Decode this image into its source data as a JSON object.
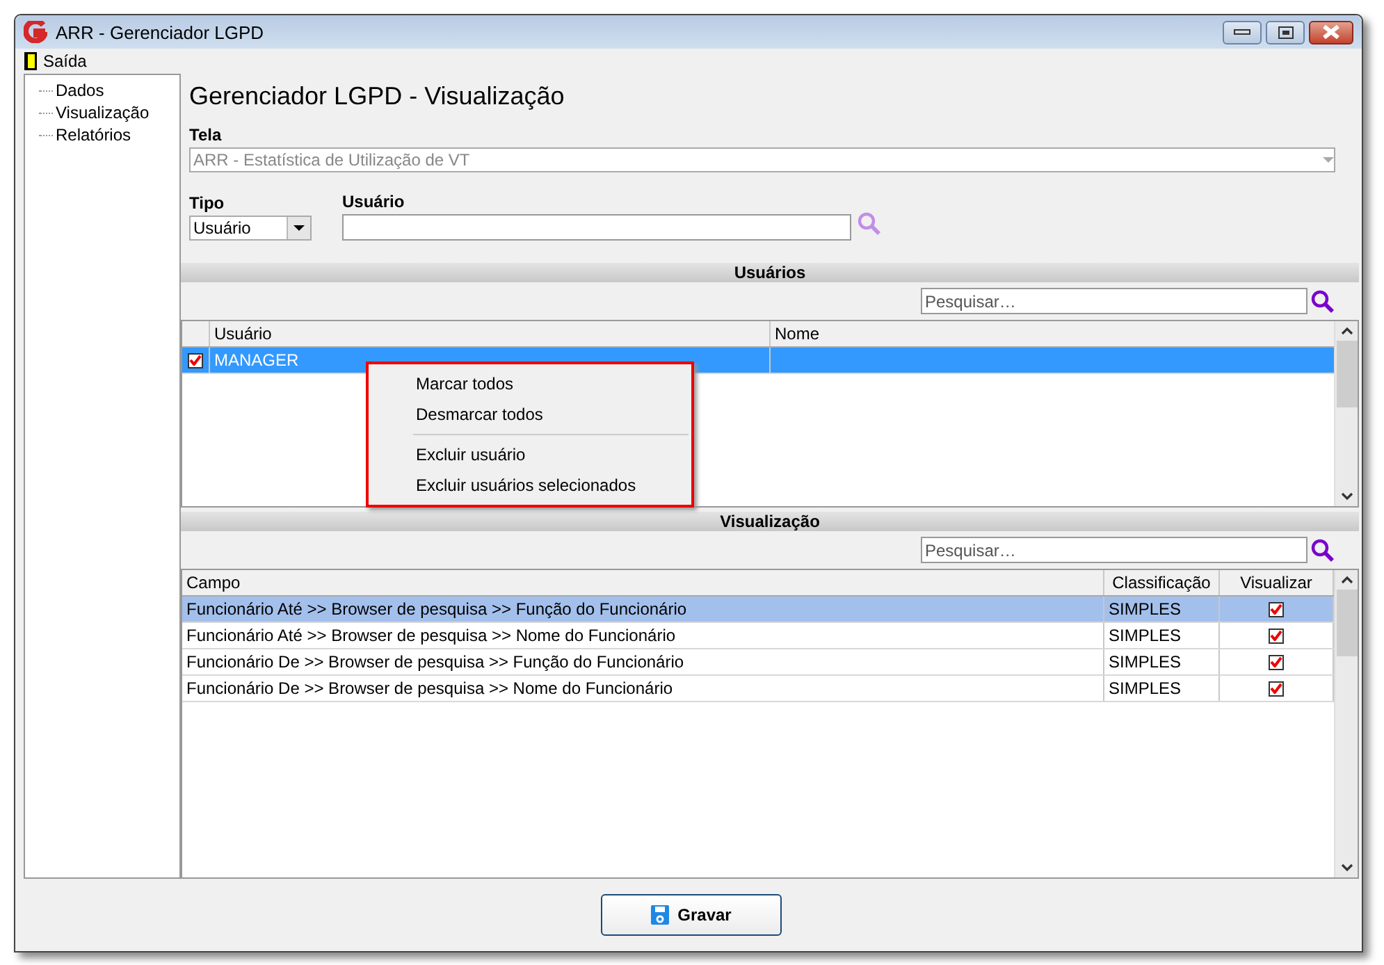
{
  "window": {
    "title": "ARR - Gerenciador LGPD"
  },
  "menu": [
    {
      "label": "Saída"
    }
  ],
  "sidebar": {
    "items": [
      {
        "label": "Dados"
      },
      {
        "label": "Visualização"
      },
      {
        "label": "Relatórios"
      }
    ]
  },
  "heading": "Gerenciador LGPD - Visualização",
  "tela": {
    "label": "Tela",
    "value": "ARR - Estatística de Utilização de VT",
    "disabled": true
  },
  "tipo": {
    "label": "Tipo",
    "value": "Usuário"
  },
  "usuario": {
    "label": "Usuário"
  },
  "usuarios": {
    "title": "Usuários",
    "search": {
      "placeholder": "Pesquisar…"
    },
    "columns": [
      "Usuário",
      "Nome"
    ],
    "rows": [
      {
        "usuario": "MANAGER",
        "checked": true,
        "selected": true
      }
    ]
  },
  "context_menu": {
    "groups": [
      [
        {
          "label": "Marcar todos"
        },
        {
          "label": "Desmarcar todos"
        }
      ],
      [
        {
          "label": "Excluir usuário"
        },
        {
          "label": "Excluir usuários selecionados"
        }
      ]
    ]
  },
  "visualizacao": {
    "title": "Visualização",
    "search": {
      "placeholder": "Pesquisar…"
    },
    "columns": [
      "Campo",
      "Classificação",
      "Visualizar"
    ],
    "rows": [
      {
        "campo": "Funcionário Até >> Browser de pesquisa >> Função do Funcionário",
        "classificacao": "SIMPLES",
        "visualizar": true,
        "selected": true
      },
      {
        "campo": "Funcionário Até >> Browser de pesquisa >> Nome do Funcionário",
        "classificacao": "SIMPLES",
        "visualizar": true,
        "selected": false
      },
      {
        "campo": "Funcionário De >> Browser de pesquisa >> Função do Funcionário",
        "classificacao": "SIMPLES",
        "visualizar": true,
        "selected": false
      },
      {
        "campo": "Funcionário De >> Browser de pesquisa >> Nome do Funcionário",
        "classificacao": "SIMPLES",
        "visualizar": true,
        "selected": false
      }
    ]
  },
  "save_button": {
    "label": "Gravar"
  }
}
